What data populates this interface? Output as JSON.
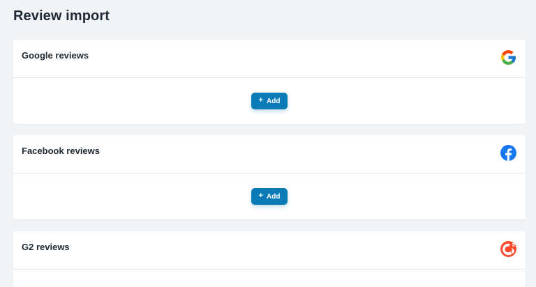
{
  "page": {
    "title": "Review import"
  },
  "cards": [
    {
      "title": "Google reviews",
      "icon": "google-icon",
      "button_label": "Add",
      "button_icon": "+"
    },
    {
      "title": "Facebook reviews",
      "icon": "facebook-icon",
      "button_label": "Add",
      "button_icon": "+"
    },
    {
      "title": "G2 reviews",
      "icon": "g2-icon"
    }
  ],
  "colors": {
    "background": "#f1f4f7",
    "card": "#ffffff",
    "primary_button": "#0a7bb6",
    "facebook_blue": "#1877f2",
    "g2_red": "#ff492c"
  }
}
